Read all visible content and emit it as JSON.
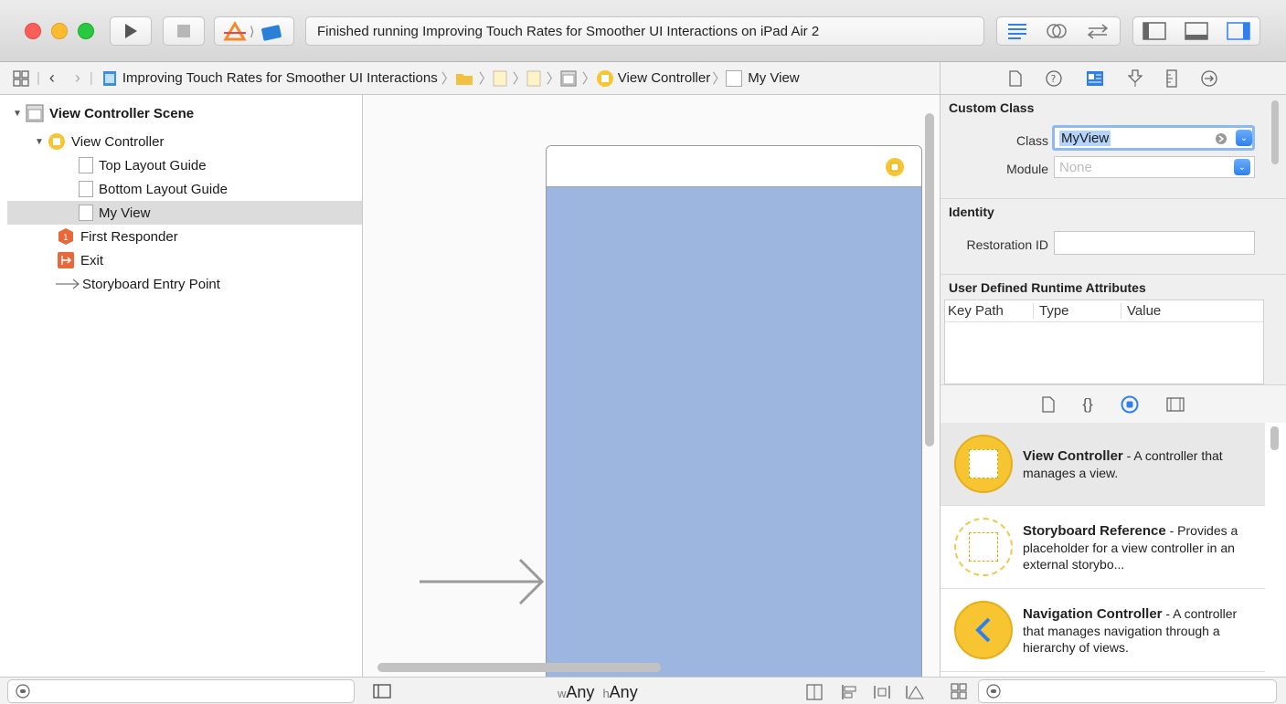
{
  "toolbar": {
    "status_text": "Finished running Improving Touch Rates for Smoother UI Interactions on iPad Air 2"
  },
  "jumpbar": {
    "project": "Improving Touch Rates for Smoother UI Interactions",
    "crumb_controller": "View Controller",
    "crumb_view": "My View"
  },
  "outline": {
    "scene": "View Controller Scene",
    "controller": "View Controller",
    "top_guide": "Top Layout Guide",
    "bottom_guide": "Bottom Layout Guide",
    "my_view": "My View",
    "first_responder": "First Responder",
    "exit": "Exit",
    "entry_point": "Storyboard Entry Point"
  },
  "inspector": {
    "custom_class_header": "Custom Class",
    "class_label": "Class",
    "class_value": "MyView",
    "module_label": "Module",
    "module_placeholder": "None",
    "identity_header": "Identity",
    "restoration_label": "Restoration ID",
    "restoration_value": "",
    "runtime_header": "User Defined Runtime Attributes",
    "col_keypath": "Key Path",
    "col_type": "Type",
    "col_value": "Value"
  },
  "library": {
    "items": [
      {
        "title": "View Controller",
        "desc": " - A controller that manages a view."
      },
      {
        "title": "Storyboard Reference",
        "desc": " - Provides a placeholder for a view controller in an external storybo..."
      },
      {
        "title": "Navigation Controller",
        "desc": " - A controller that manages navigation through a hierarchy of views."
      }
    ]
  },
  "bottombar": {
    "size_w_prefix": "w",
    "size_w": "Any",
    "size_h_prefix": "h",
    "size_h": "Any"
  },
  "colors": {
    "accent": "#2f7ff0",
    "view_fill": "#9cb6e0",
    "vc_yellow": "#f7c531",
    "exit_orange": "#e8683a"
  }
}
